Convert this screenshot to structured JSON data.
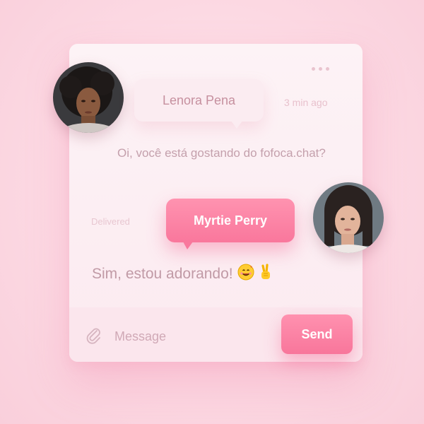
{
  "colors": {
    "accent": "#f8799e",
    "background": "#fcd9e3",
    "card": "#fdf1f5",
    "muted_text": "#c4a0ac"
  },
  "header": {
    "menu_icon": "more-horizontal-icon"
  },
  "conversation": {
    "incoming": {
      "sender": "Lenora Pena",
      "time": "3 min ago",
      "text": "Oi, você está gostando do fofoca.chat?"
    },
    "outgoing": {
      "status": "Delivered",
      "sender": "Myrtie Perry",
      "text": "Sim, estou adorando!",
      "emojis": [
        "smiling-face-with-hearts-icon",
        "victory-hand-icon"
      ]
    }
  },
  "composer": {
    "attach_icon": "paperclip-icon",
    "placeholder": "Message",
    "send_label": "Send"
  }
}
